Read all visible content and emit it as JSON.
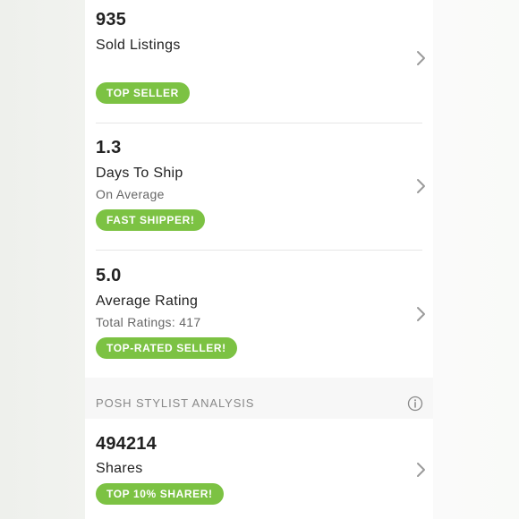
{
  "stats": [
    {
      "value": "935",
      "label": "Sold Listings",
      "sub": "",
      "badge": "TOP SELLER"
    },
    {
      "value": "1.3",
      "label": "Days To Ship",
      "sub": "On Average",
      "badge": "FAST SHIPPER!"
    },
    {
      "value": "5.0",
      "label": "Average Rating",
      "sub": "Total Ratings: 417",
      "badge": "TOP-RATED SELLER!"
    }
  ],
  "section": {
    "title": "POSH STYLIST ANALYSIS",
    "info_icon": "info-icon"
  },
  "shares": {
    "value": "494214",
    "label": "Shares",
    "badge": "TOP 10% SHARER!"
  },
  "colors": {
    "badge": "#7cc243",
    "text": "#222222",
    "muted": "#666666"
  },
  "icons": {
    "row_arrow": "chevron-right-icon"
  }
}
